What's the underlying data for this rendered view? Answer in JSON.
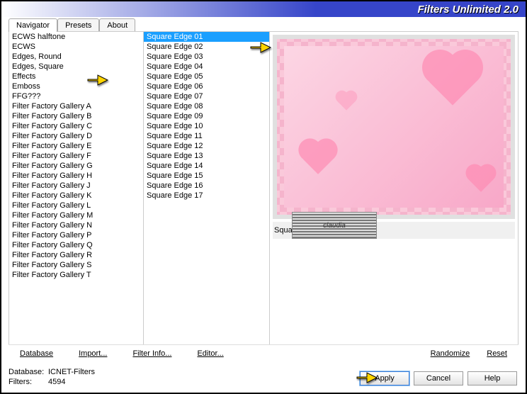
{
  "title": "Filters Unlimited 2.0",
  "tabs": {
    "t0": "Navigator",
    "t1": "Presets",
    "t2": "About"
  },
  "categories": [
    "ECWS halftone",
    "ECWS",
    "Edges, Round",
    "Edges, Square",
    "Effects",
    "Emboss",
    "FFG???",
    "Filter Factory Gallery A",
    "Filter Factory Gallery B",
    "Filter Factory Gallery C",
    "Filter Factory Gallery D",
    "Filter Factory Gallery E",
    "Filter Factory Gallery F",
    "Filter Factory Gallery G",
    "Filter Factory Gallery H",
    "Filter Factory Gallery J",
    "Filter Factory Gallery K",
    "Filter Factory Gallery L",
    "Filter Factory Gallery M",
    "Filter Factory Gallery N",
    "Filter Factory Gallery P",
    "Filter Factory Gallery Q",
    "Filter Factory Gallery R",
    "Filter Factory Gallery S",
    "Filter Factory Gallery T"
  ],
  "filters": [
    "Square Edge 01",
    "Square Edge 02",
    "Square Edge 03",
    "Square Edge 04",
    "Square Edge 05",
    "Square Edge 06",
    "Square Edge 07",
    "Square Edge 08",
    "Square Edge 09",
    "Square Edge 10",
    "Square Edge 11",
    "Square Edge 12",
    "Square Edge 13",
    "Square Edge 14",
    "Square Edge 15",
    "Square Edge 16",
    "Square Edge 17"
  ],
  "selectedCategoryIndex": 3,
  "selectedFilterIndex": 0,
  "preview": {
    "caption": "Square Edge 01"
  },
  "watermark": "claudia",
  "midButtons": {
    "database": "Database",
    "import": "Import...",
    "filterInfo": "Filter Info...",
    "editor": "Editor...",
    "randomize": "Randomize",
    "reset": "Reset"
  },
  "status": {
    "dbLabel": "Database:",
    "dbValue": "ICNET-Filters",
    "filtersLabel": "Filters:",
    "filtersValue": "4594"
  },
  "buttons": {
    "apply": "Apply",
    "cancel": "Cancel",
    "help": "Help"
  }
}
